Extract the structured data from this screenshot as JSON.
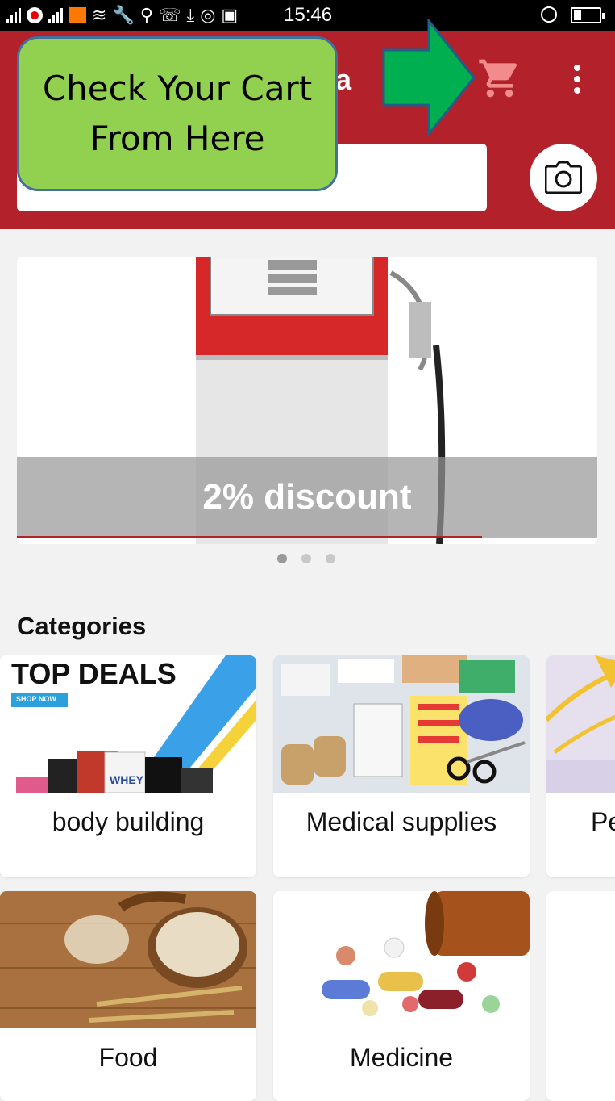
{
  "status_bar": {
    "time": "15:46"
  },
  "app_bar": {
    "title_visible_fragment": "a",
    "search": {
      "placeholder": ""
    }
  },
  "callout": {
    "line1": "Check Your Cart",
    "line2": "From Here"
  },
  "banner": {
    "caption": "2% discount",
    "slide_index": 1,
    "slide_count": 3
  },
  "categories": {
    "title": "Categories",
    "top_deals_text": "TOP DEALS",
    "shop_now_text": "SHOP NOW",
    "whey_text": "WHEY",
    "items": [
      {
        "label": "body building"
      },
      {
        "label": "Medical supplies"
      },
      {
        "label": "Pe"
      },
      {
        "label": "Food"
      },
      {
        "label": "Medicine"
      },
      {
        "label": ""
      }
    ]
  },
  "colors": {
    "app_bar": "#b3222a",
    "callout_fill": "#92d050",
    "callout_border": "#41719c",
    "arrow": "#00b050"
  }
}
